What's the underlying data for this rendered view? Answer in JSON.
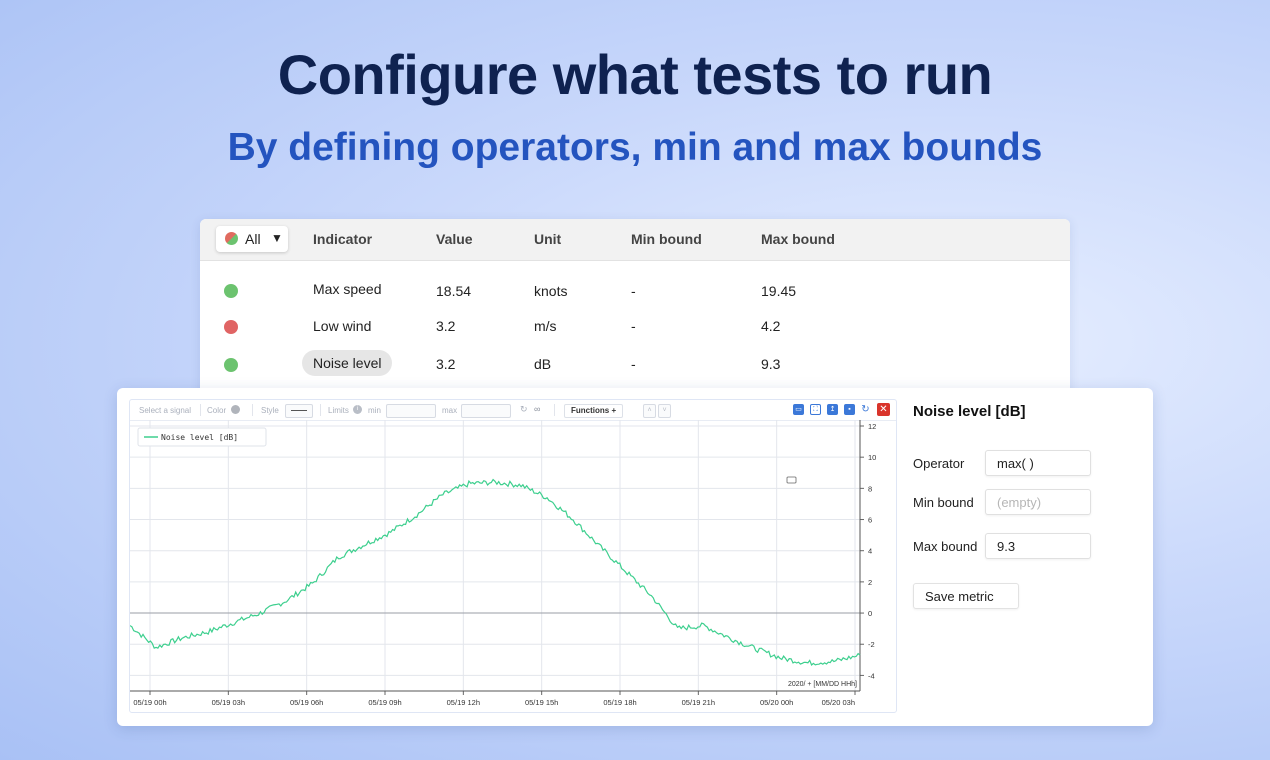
{
  "hero": {
    "title": "Configure what tests to run",
    "subtitle": "By defining operators, min and max bounds"
  },
  "metrics_table": {
    "filter": {
      "label": "All",
      "caret": "▼"
    },
    "columns": [
      "Indicator",
      "Value",
      "Unit",
      "Min bound",
      "Max bound"
    ],
    "rows": [
      {
        "status": "pass",
        "status_color": "#6cc36f",
        "indicator": "Max speed",
        "value": "18.54",
        "unit": "knots",
        "min_bound": "-",
        "max_bound": "19.45"
      },
      {
        "status": "fail",
        "status_color": "#e06464",
        "indicator": "Low wind",
        "value": "3.2",
        "unit": "m/s",
        "min_bound": "-",
        "max_bound": "4.2"
      },
      {
        "status": "pass",
        "status_color": "#6cc36f",
        "indicator": "Noise level",
        "value": "3.2",
        "unit": "dB",
        "min_bound": "-",
        "max_bound": "9.3",
        "selected": true
      }
    ]
  },
  "chart_toolbar": {
    "signal_placeholder": "Select a signal",
    "color_label": "Color",
    "style_label": "Style",
    "limits_label": "Limits",
    "min_label": "min",
    "max_label": "max",
    "functions_label": "Functions",
    "icons": [
      "comment-icon",
      "fullscreen-icon",
      "export-icon",
      "image-icon",
      "refresh-icon",
      "close-icon"
    ]
  },
  "chart_data": {
    "type": "line",
    "legend": [
      "Noise level [dB]"
    ],
    "series": [
      {
        "name": "Noise level [dB]",
        "color": "#3dcf8e",
        "x": [
          0,
          1,
          2,
          3,
          4,
          5,
          6,
          7,
          8,
          9,
          10,
          11,
          12,
          13,
          14,
          15,
          16,
          17,
          18,
          19,
          20,
          21,
          22,
          23,
          24,
          25,
          26,
          27,
          28
        ],
        "y": [
          -0.8,
          -2.2,
          -1.6,
          -1.2,
          -0.6,
          0.0,
          0.8,
          1.9,
          3.6,
          4.4,
          5.2,
          6.3,
          7.6,
          8.3,
          8.4,
          8.2,
          7.4,
          6.0,
          4.3,
          2.7,
          1.1,
          -1.0,
          -0.8,
          -1.6,
          -2.3,
          -2.9,
          -3.2,
          -3.1,
          -2.7
        ]
      }
    ],
    "x_ticks": [
      "05/19 00h",
      "05/19 03h",
      "05/19 06h",
      "05/19 09h",
      "05/19 12h",
      "05/19 15h",
      "05/19 18h",
      "05/19 21h",
      "05/20 00h",
      "05/20 03h"
    ],
    "y_ticks": [
      "12",
      "10",
      "8",
      "6",
      "4",
      "2",
      "0",
      "-2",
      "-4"
    ],
    "x_format_note": "2020/ + [MM/DD HHh]",
    "ylim": [
      -5,
      12
    ],
    "grid": true
  },
  "metric_form": {
    "title": "Noise level [dB]",
    "operator_label": "Operator",
    "operator_value": "max( )",
    "min_label": "Min bound",
    "min_placeholder": "(empty)",
    "max_label": "Max bound",
    "max_value": "9.3",
    "save_label": "Save metric"
  }
}
